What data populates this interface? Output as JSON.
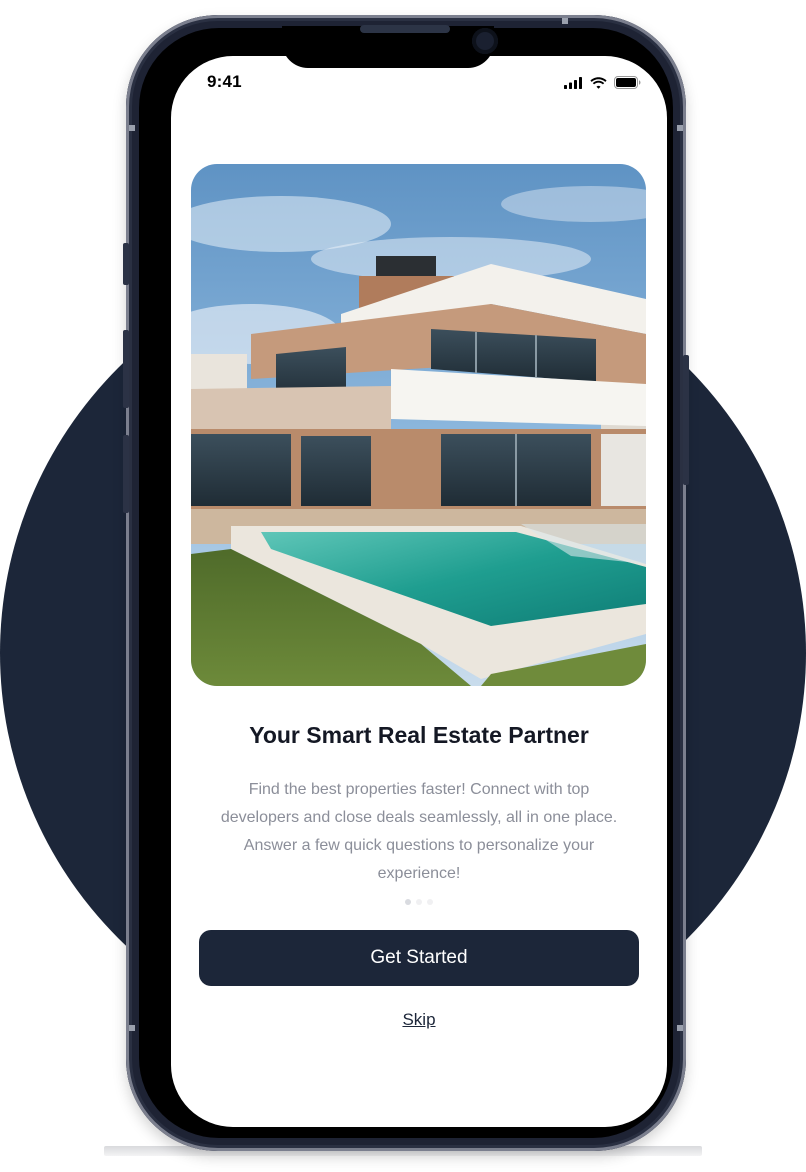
{
  "status_bar": {
    "time": "9:41",
    "icons": [
      "cellular-signal-icon",
      "wifi-icon",
      "battery-icon"
    ]
  },
  "onboarding": {
    "hero_image": "modern-villa-with-pool-photo",
    "title": "Your Smart Real Estate Partner",
    "description": "Find the best properties faster! Connect with top developers and close deals seamlessly, all in one place. Answer a few quick questions to personalize your experience!",
    "pagination": {
      "total": 3,
      "current": 1
    },
    "primary_button": "Get Started",
    "skip_link": "Skip"
  },
  "colors": {
    "brand_navy": "#1c2639",
    "title_text": "#141824",
    "body_text": "#8b8e99",
    "dot_active": "#d9dbe0",
    "dot_inactive": "#f0f0f2",
    "background": "#ffffff"
  }
}
